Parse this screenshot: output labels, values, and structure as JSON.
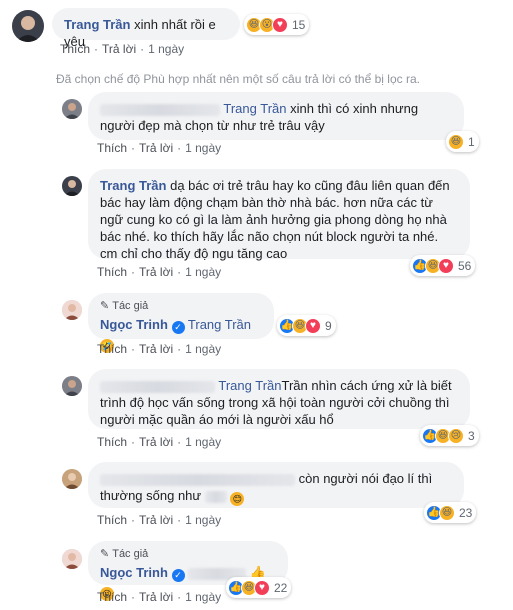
{
  "labels": {
    "like": "Thích",
    "reply": "Trả lời",
    "author": "Tác giả"
  },
  "notice": "Đã chọn chế độ Phù hợp nhất nên một số câu trả lời có thể bị lọc ra.",
  "comments": [
    {
      "name": "Trang Trần",
      "text": "xinh nhất rồi e yêu",
      "time": "1 ngày",
      "count": "15"
    },
    {
      "name": "",
      "mention": "Trang Trần",
      "text": "xinh thì có xinh nhưng người đẹp mà chọn từ như trẻ trâu vậy",
      "time": "1 ngày",
      "count": "1"
    },
    {
      "name": "Trang Trần",
      "text": "dạ bác ơi trẻ trâu hay ko cũng đâu liên quan đến bác hay làm động chạm bàn thờ nhà bác. hơn nữa các từ ngữ cung ko có gì la làm ảnh hưởng gia phong dòng họ nhà bác nhé. ko thích hãy lắc não chọn nút block người ta nhé. cm chỉ cho thấy độ ngu tăng cao",
      "time": "1 ngày",
      "count": "56"
    },
    {
      "name": "Ngọc Trinh",
      "mention": "Trang Trần",
      "text": "",
      "time": "1 ngày",
      "count": "9"
    },
    {
      "name": "",
      "mention": "Trang Trần",
      "text": "Trần nhìn cách ứng xử là biết trình độ học vấn sống trong xã hội toàn người cởi chuồng thì người mặc quần áo mới là người xấu hổ",
      "time": "1 ngày",
      "count": "3"
    },
    {
      "name": "",
      "mention": "",
      "text": "còn người nói đạo lí thì thường sống như",
      "time": "1 ngày",
      "count": "23"
    },
    {
      "name": "Ngọc Trinh",
      "mention": "",
      "text": "",
      "time": "1 ngày",
      "count": "22"
    }
  ]
}
